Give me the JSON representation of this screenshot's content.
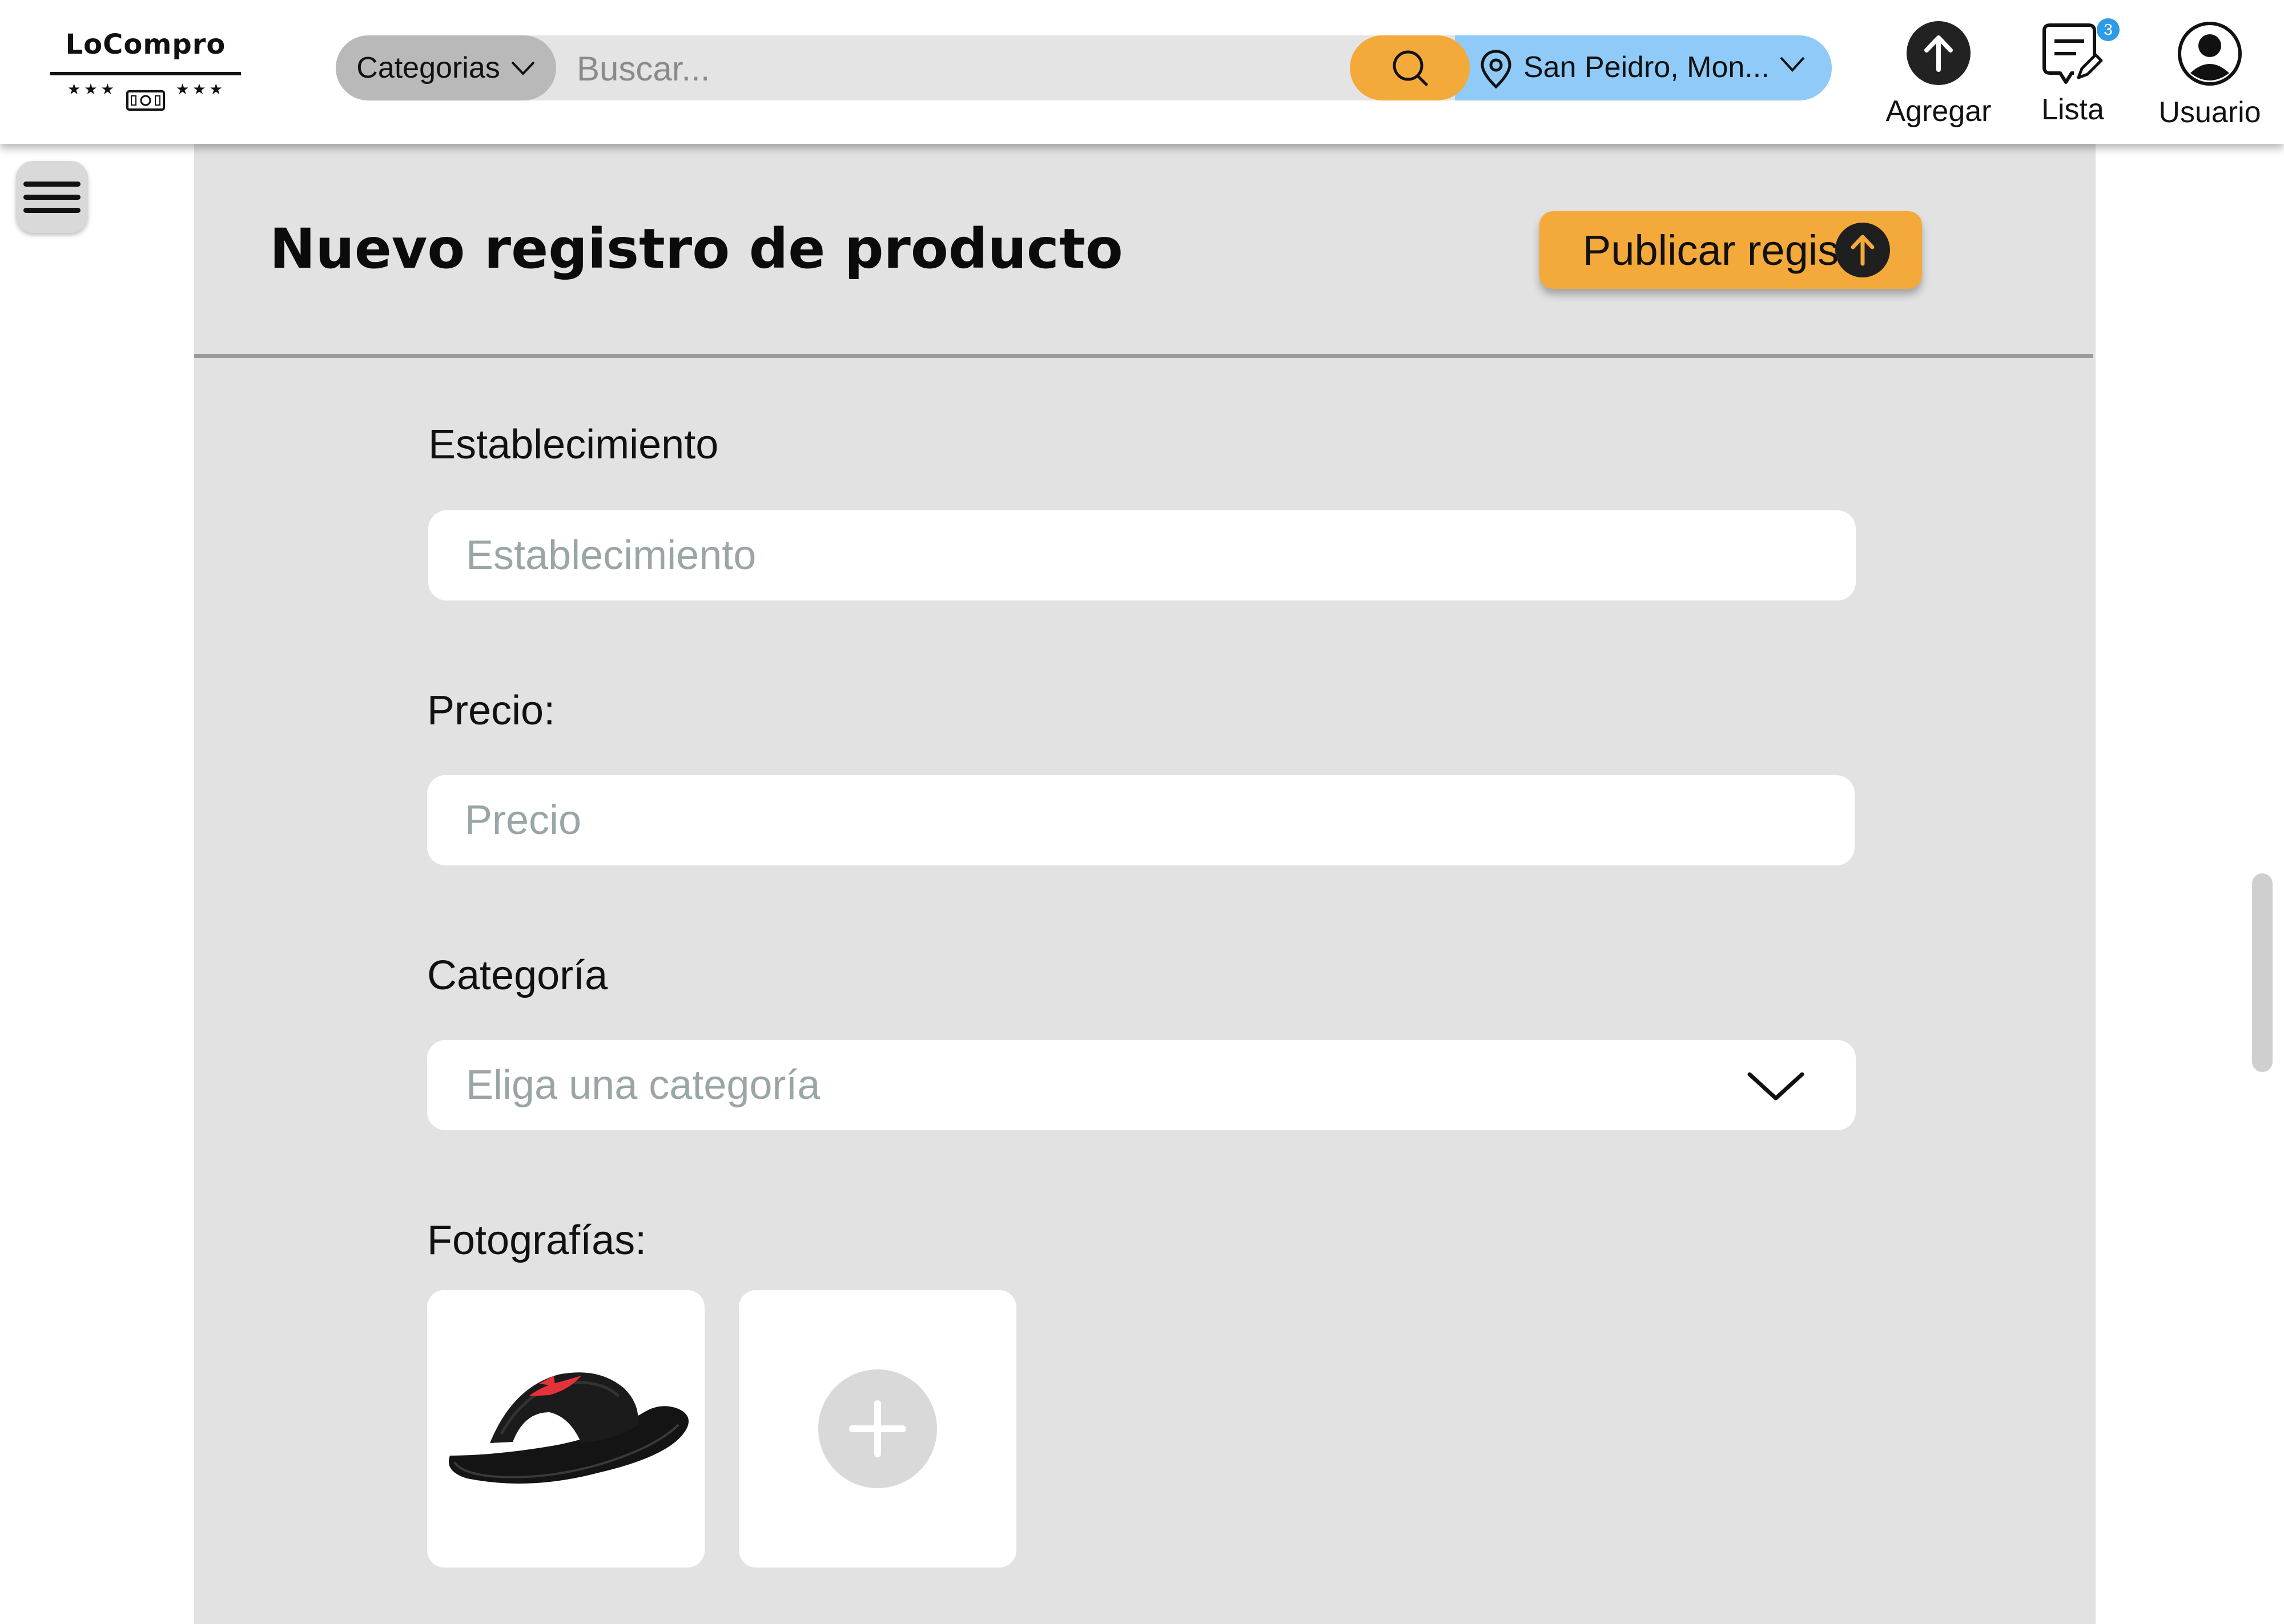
{
  "navbar": {
    "logo": {
      "text": "LoCompro",
      "stars_left": "★★★",
      "stars_right": "★★★"
    },
    "categories_label": "Categorias",
    "search_placeholder": "Buscar...",
    "location": "San Peidro, Mon...",
    "actions": {
      "add_label": "Agregar",
      "list_label": "Lista",
      "list_badge": "3",
      "user_label": "Usuario"
    },
    "colors": {
      "search_button": "#f4a93b",
      "location_pill": "#8fcaf8",
      "category_button": "#b9b9b9"
    }
  },
  "page": {
    "title": "Nuevo registro de producto",
    "publish_label": "Publicar registro"
  },
  "form": {
    "establishment": {
      "label": "Establecimiento",
      "placeholder": "Establecimiento"
    },
    "price": {
      "label": "Precio:",
      "placeholder": "Precio"
    },
    "category": {
      "label": "Categoría",
      "placeholder": "Eliga una categoría"
    },
    "photos": {
      "label": "Fotografías:",
      "items": [
        "sandal-photo"
      ],
      "add_icon": "plus-icon"
    }
  },
  "colors": {
    "panel_bg": "#e2e2e2",
    "accent": "#f4a93b",
    "badge": "#2e9be6"
  }
}
